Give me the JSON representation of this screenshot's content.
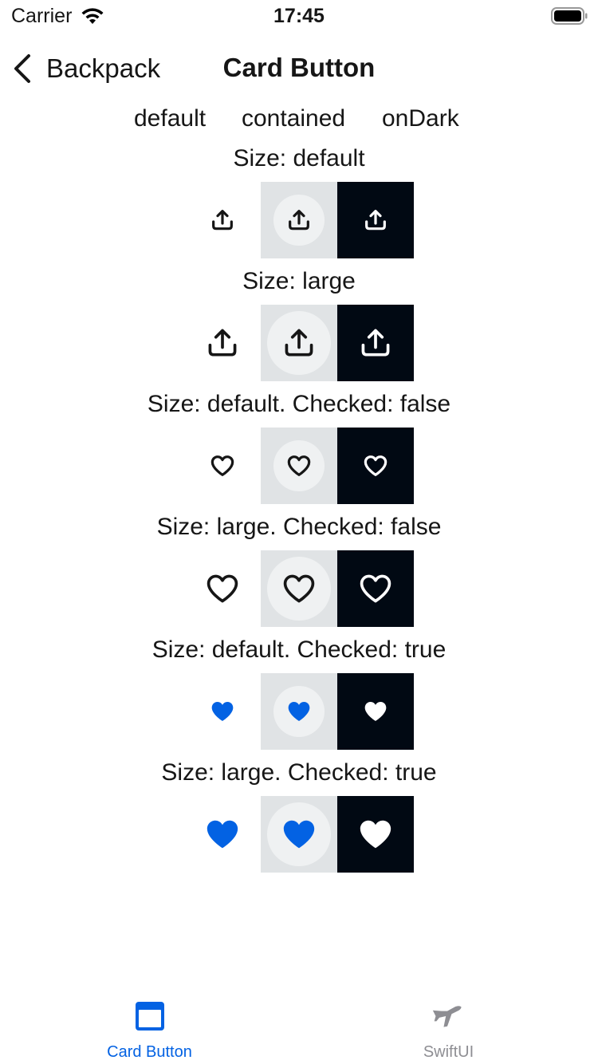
{
  "status_bar": {
    "carrier": "Carrier",
    "time": "17:45"
  },
  "nav": {
    "back_label": "Backpack",
    "title": "Card Button"
  },
  "columns": [
    "default",
    "contained",
    "onDark"
  ],
  "sections": [
    {
      "label": "Size: default",
      "icon": "share-icon",
      "size": "default",
      "checked": null
    },
    {
      "label": "Size: large",
      "icon": "share-icon",
      "size": "large",
      "checked": null
    },
    {
      "label": "Size: default. Checked: false",
      "icon": "heart-outline-icon",
      "size": "default",
      "checked": false
    },
    {
      "label": "Size: large. Checked: false",
      "icon": "heart-outline-icon",
      "size": "large",
      "checked": false
    },
    {
      "label": "Size: default. Checked: true",
      "icon": "heart-filled-icon",
      "size": "default",
      "checked": true
    },
    {
      "label": "Size: large. Checked: true",
      "icon": "heart-filled-icon",
      "size": "large",
      "checked": true
    }
  ],
  "tab_bar": {
    "tabs": [
      {
        "label": "Card Button",
        "icon": "card-button-icon",
        "selected": true
      },
      {
        "label": "SwiftUI",
        "icon": "airplane-icon",
        "selected": false
      }
    ]
  },
  "colors": {
    "accent": "#0362e3",
    "on_dark_background": "#010913",
    "contained_background": "#e0e3e5",
    "contained_circle": "#eff1f2",
    "text": "#161616",
    "tab_inactive": "#8e8e93"
  }
}
